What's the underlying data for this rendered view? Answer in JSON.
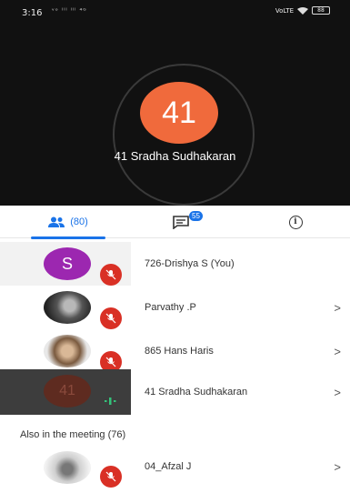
{
  "status_bar": {
    "time": "3:16",
    "signal_text": "ᵛᵒ ˡˡˡ ˡˡˡ ⁴ᴳ",
    "right_text": "VoLTE",
    "battery": "88"
  },
  "call": {
    "avatar_text": "41",
    "name": "41 Sradha Sudhakaran"
  },
  "tabs": {
    "people_count": "(80)",
    "chat_badge": "55"
  },
  "participants": [
    {
      "avatar_text": "S",
      "avatar_color": "#9c27b0",
      "name": "726-Drishya S (You)",
      "muted": true,
      "chevron": ""
    },
    {
      "avatar_text": "",
      "avatar_color": "#4a4a4a",
      "name": "Parvathy .P",
      "muted": true,
      "chevron": ">"
    },
    {
      "avatar_text": "",
      "avatar_color": "#8a6a4f",
      "name": "865 Hans Haris",
      "muted": true,
      "chevron": ">"
    },
    {
      "avatar_text": "41",
      "avatar_color": "#5e2b20",
      "name": "41 Sradha Sudhakaran",
      "muted": false,
      "chevron": ">"
    }
  ],
  "section_label": "Also in the meeting (76)",
  "others": [
    {
      "avatar_text": "",
      "avatar_color": "#cfcfcf",
      "name": "04_Afzal J",
      "muted": true,
      "chevron": ">"
    }
  ]
}
